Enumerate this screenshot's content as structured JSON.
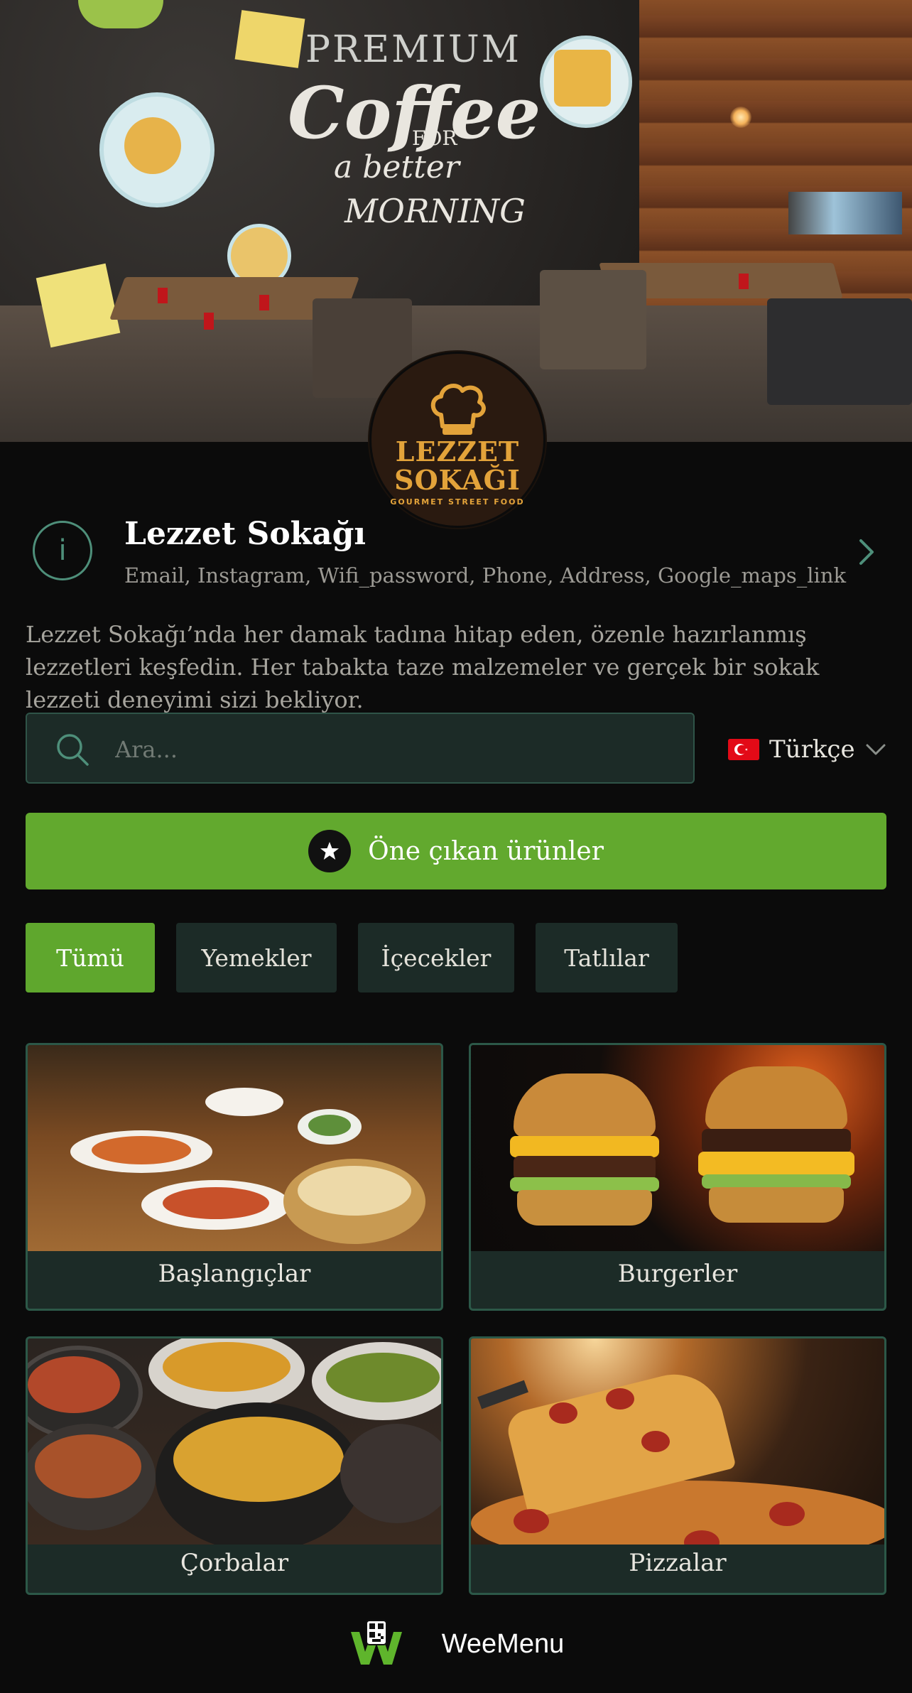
{
  "hero": {
    "chalk_line1": "PREMIUM",
    "chalk_line2": "Coffee",
    "chalk_line3": "FOR",
    "chalk_line4": "a better",
    "chalk_line5": "MORNING"
  },
  "logo": {
    "line1": "LEZZET",
    "line2": "SOKAĞI",
    "tagline": "GOURMET STREET FOOD",
    "color": "#e3a33a"
  },
  "info": {
    "icon": "info-icon",
    "title": "Lezzet Sokağı",
    "subtitle": "Email, Instagram, Wifi_password, Phone, Address, Google_maps_link"
  },
  "description": "Lezzet Sokağı’nda her damak tadına hitap eden, özenle hazırlanmış lezzetleri keşfedin. Her tabakta taze malzemeler ve gerçek bir sokak lezzeti deneyimi sizi bekliyor.",
  "search": {
    "placeholder": "Ara...",
    "value": ""
  },
  "language": {
    "selected": "Türkçe",
    "flag": "turkey-flag"
  },
  "featured": {
    "label": "Öne çıkan ürünler",
    "icon": "star-icon",
    "color": "#62a92e"
  },
  "tabs": [
    {
      "label": "Tümü",
      "active": true
    },
    {
      "label": "Yemekler",
      "active": false
    },
    {
      "label": "İçecekler",
      "active": false
    },
    {
      "label": "Tatlılar",
      "active": false
    }
  ],
  "categories": [
    {
      "label": "Başlangıçlar"
    },
    {
      "label": "Burgerler"
    },
    {
      "label": "Çorbalar"
    },
    {
      "label": "Pizzalar"
    }
  ],
  "footer": {
    "brand": "WeeMenu"
  },
  "colors": {
    "accent_green": "#5fa72d",
    "panel": "#1c2b27",
    "border": "#2c5848",
    "background": "#0b0b0b"
  }
}
